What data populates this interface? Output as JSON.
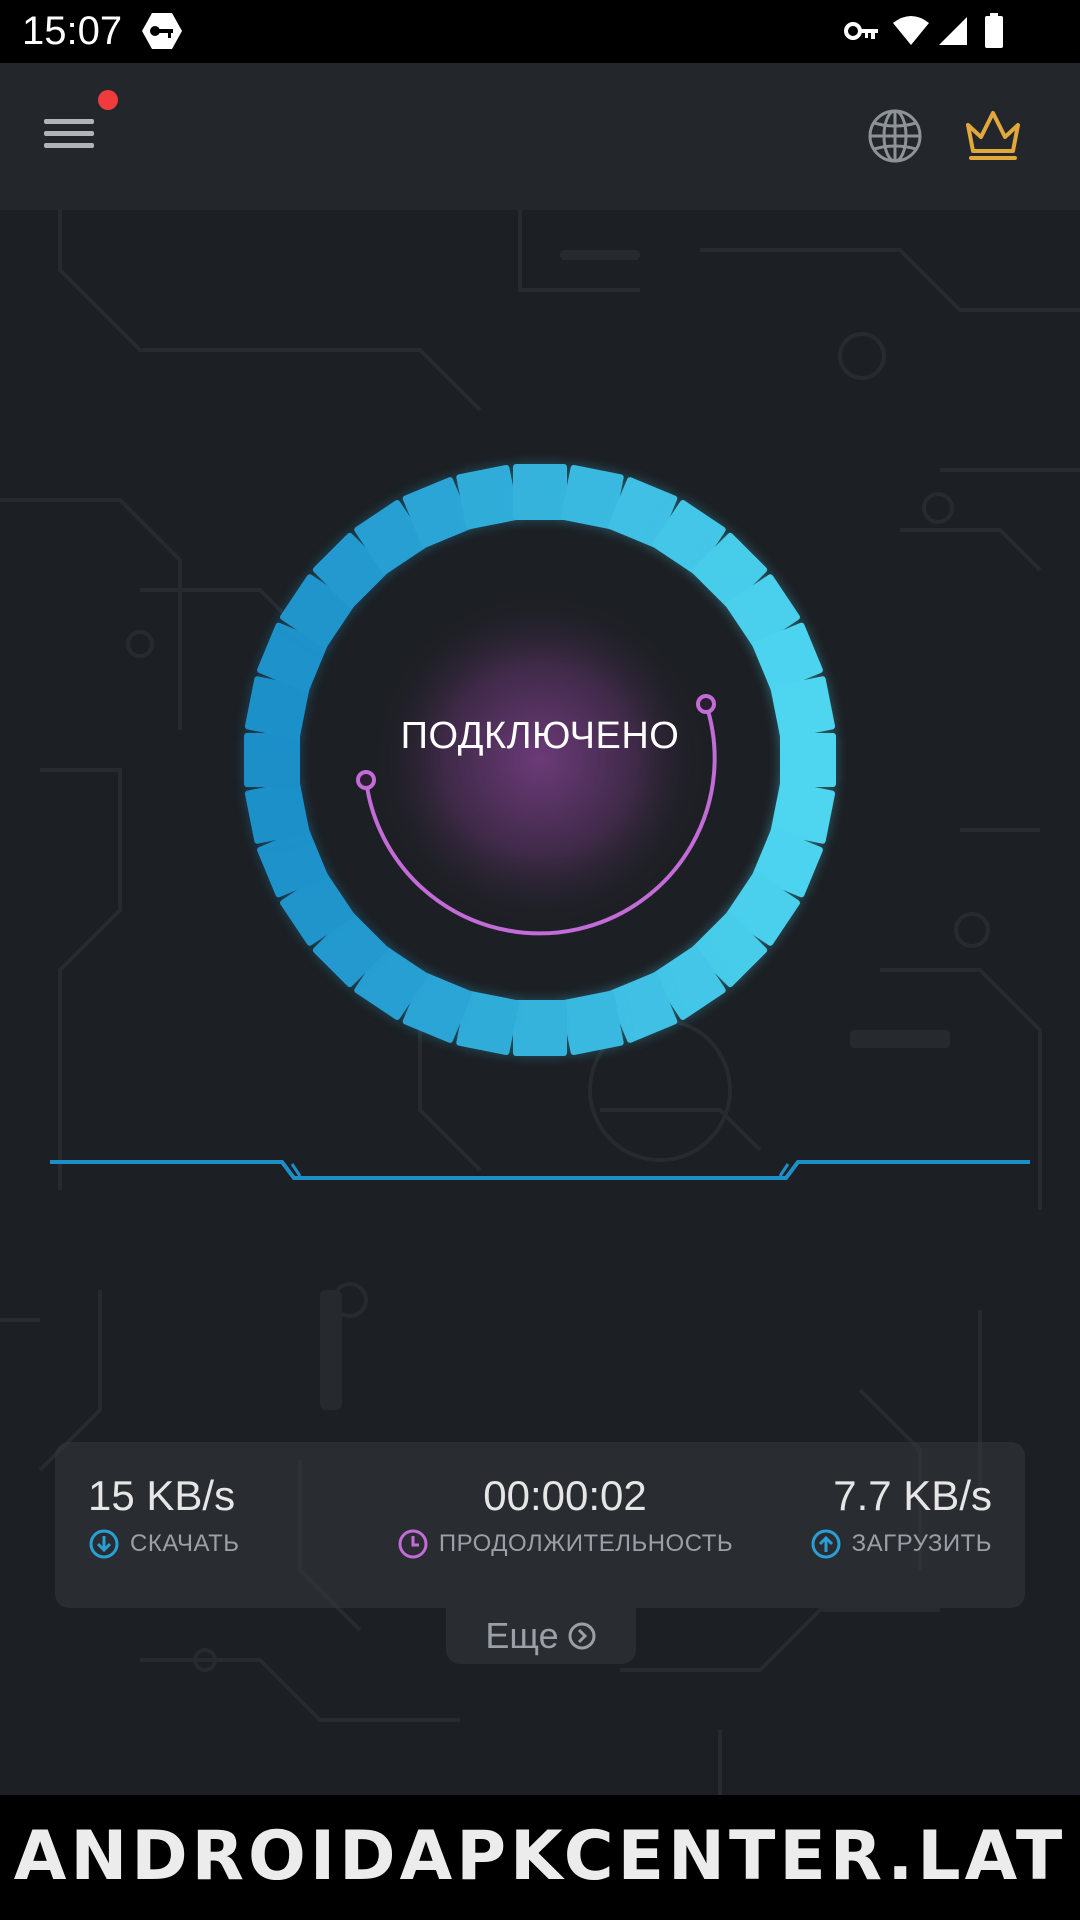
{
  "status_bar": {
    "time": "15:07",
    "icons": [
      "vpn-key-badge-icon",
      "key-icon",
      "wifi-icon",
      "signal-icon",
      "battery-icon"
    ]
  },
  "app_bar": {
    "menu_icon": "hamburger-menu-icon",
    "has_notification": true,
    "actions": [
      "globe-icon",
      "crown-icon"
    ]
  },
  "connection": {
    "status": "ПОДКЛЮЧЕНО"
  },
  "stats": {
    "download": {
      "value": "15 KB/s",
      "label": "СКАЧАТЬ",
      "icon": "arrow-down-circle-icon"
    },
    "duration": {
      "value": "00:00:02",
      "label": "ПРОДОЛЖИТЕЛЬНОСТЬ",
      "icon": "clock-icon"
    },
    "upload": {
      "value": "7.7 KB/s",
      "label": "ЗАГРУЗИТЬ",
      "icon": "arrow-up-circle-icon"
    }
  },
  "more": {
    "label": "Еще",
    "icon": "chevron-right-circle-icon"
  },
  "watermark": "ANDROIDAPKCENTER.LAT",
  "colors": {
    "accent_blue": "#29a9dc",
    "accent_purple": "#c36bd6",
    "background": "#1c1f23",
    "appbar": "#23272b",
    "crown": "#e2a83b",
    "notification": "#ef3b3b"
  }
}
